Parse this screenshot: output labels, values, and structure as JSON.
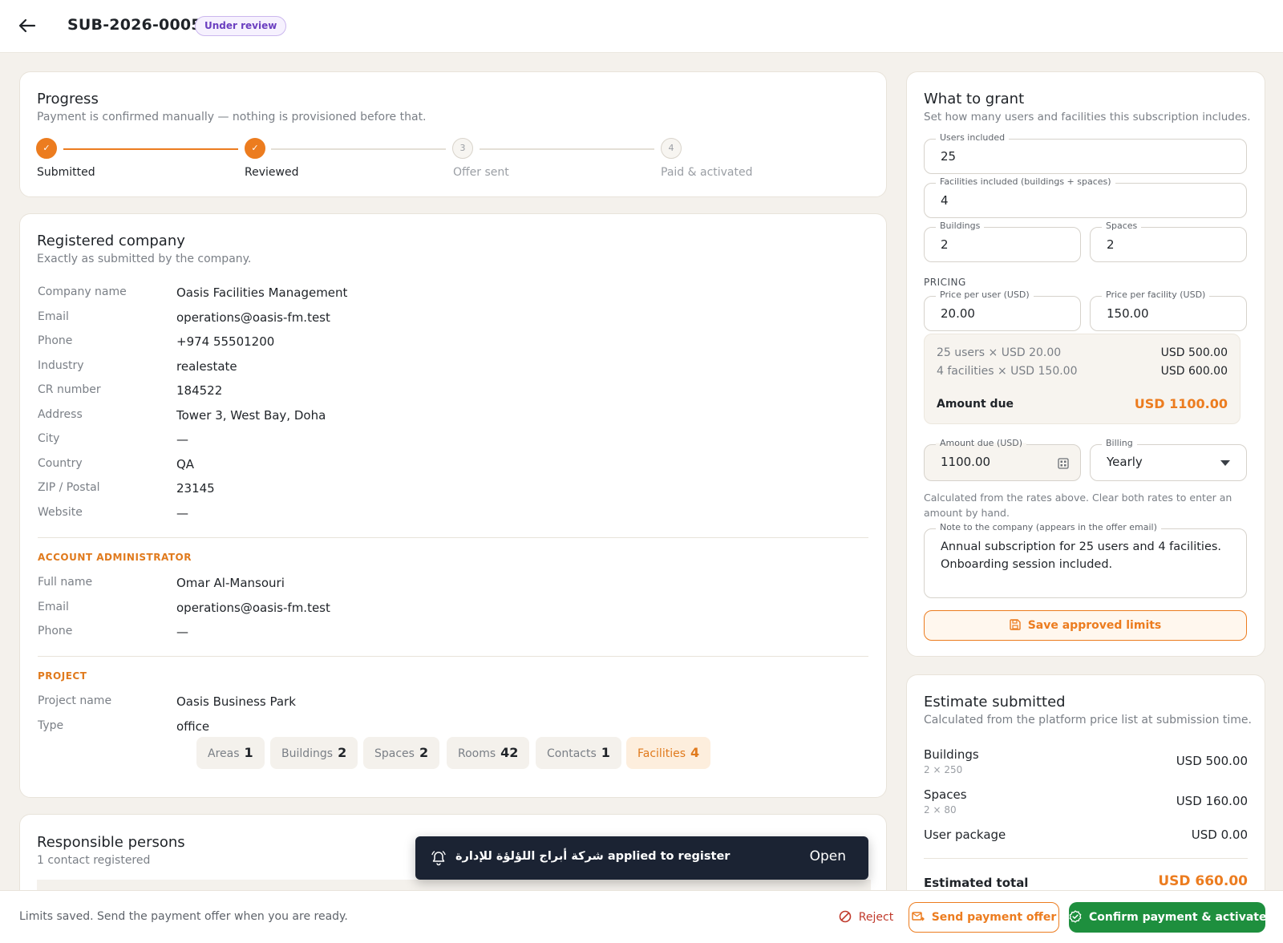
{
  "header": {
    "submission_id": "SUB-2026-0005",
    "status_badge": "Under review",
    "back_icon": "arrow-left-icon"
  },
  "progress": {
    "title": "Progress",
    "subtitle": "Payment is confirmed manually — nothing is provisioned before that.",
    "steps": [
      {
        "label": "Submitted",
        "marker": "✓",
        "state": "done"
      },
      {
        "label": "Reviewed",
        "marker": "✓",
        "state": "done"
      },
      {
        "label": "Offer sent",
        "marker": "3",
        "state": "pending"
      },
      {
        "label": "Paid & activated",
        "marker": "4",
        "state": "pending"
      }
    ]
  },
  "company": {
    "title": "Registered company",
    "subtitle": "Exactly as submitted by the company.",
    "fields": [
      {
        "key": "Company name",
        "value": "Oasis Facilities Management"
      },
      {
        "key": "Email",
        "value": "operations@oasis-fm.test"
      },
      {
        "key": "Phone",
        "value": "+974 55501200"
      },
      {
        "key": "Industry",
        "value": "realestate"
      },
      {
        "key": "CR number",
        "value": "184522"
      },
      {
        "key": "Address",
        "value": "Tower 3, West Bay, Doha"
      },
      {
        "key": "City",
        "value": "—"
      },
      {
        "key": "Country",
        "value": "QA"
      },
      {
        "key": "ZIP / Postal",
        "value": "23145"
      },
      {
        "key": "Website",
        "value": "—"
      }
    ],
    "admin_heading": "ACCOUNT ADMINISTRATOR",
    "admin_fields": [
      {
        "key": "Full name",
        "value": "Omar Al-Mansouri"
      },
      {
        "key": "Email",
        "value": "operations@oasis-fm.test"
      },
      {
        "key": "Phone",
        "value": "—"
      }
    ],
    "project_heading": "PROJECT",
    "project_fields": [
      {
        "key": "Project name",
        "value": "Oasis Business Park"
      },
      {
        "key": "Type",
        "value": "office"
      }
    ],
    "chips": [
      {
        "label": "Areas",
        "count": "1"
      },
      {
        "label": "Buildings",
        "count": "2"
      },
      {
        "label": "Spaces",
        "count": "2"
      },
      {
        "label": "Rooms",
        "count": "42"
      },
      {
        "label": "Contacts",
        "count": "1"
      },
      {
        "label": "Facilities",
        "count": "4"
      }
    ]
  },
  "responsible": {
    "title": "Responsible persons",
    "subtitle": "1 contact registered"
  },
  "grant": {
    "title": "What to grant",
    "subtitle": "Set how many users and facilities this subscription includes.",
    "users_label": "Users included",
    "users_value": "25",
    "facilities_label": "Facilities included (buildings + spaces)",
    "facilities_value": "4",
    "buildings_label": "Buildings",
    "buildings_value": "2",
    "spaces_label": "Spaces",
    "spaces_value": "2",
    "pricing_heading": "PRICING",
    "price_user_label": "Price per user (USD)",
    "price_user_value": "20.00",
    "price_facility_label": "Price per facility (USD)",
    "price_facility_value": "150.00",
    "summary": {
      "line1_label": "25 users × USD 20.00",
      "line1_value": "USD 500.00",
      "line2_label": "4 facilities × USD 150.00",
      "line2_value": "USD 600.00",
      "total_label": "Amount due",
      "total_value": "USD 1100.00"
    },
    "amount_label": "Amount due (USD)",
    "amount_value": "1100.00",
    "billing_label": "Billing",
    "billing_value": "Yearly",
    "hint": "Calculated from the rates above. Clear both rates to enter an amount by hand.",
    "note_label": "Note to the company (appears in the offer email)",
    "note_value": "Annual subscription for 25 users and 4 facilities. Onboarding session included.",
    "save_button": "Save approved limits"
  },
  "estimate": {
    "title": "Estimate submitted",
    "subtitle": "Calculated from the platform price list at submission time.",
    "buildings_label": "Buildings",
    "buildings_detail": "2 × 250",
    "buildings_value": "USD 500.00",
    "spaces_label": "Spaces",
    "spaces_detail": "2 × 80",
    "spaces_value": "USD 160.00",
    "user_package_label": "User package",
    "user_package_value": "USD 0.00",
    "total_label": "Estimated total",
    "total_value": "USD 660.00"
  },
  "footer": {
    "status_text": "Limits saved. Send the payment offer when you are ready.",
    "reject_label": "Reject",
    "send_offer_label": "Send payment offer",
    "confirm_label": "Confirm payment & activate"
  },
  "toast": {
    "message": "شركة أبراج اللؤلؤة للإدارة applied to register",
    "action": "Open"
  },
  "colors": {
    "accent": "#ec7c1f",
    "success": "#1e8f3e",
    "danger": "#c0392b",
    "badge": "#6b3fc0",
    "toast_bg": "#1b2333"
  }
}
